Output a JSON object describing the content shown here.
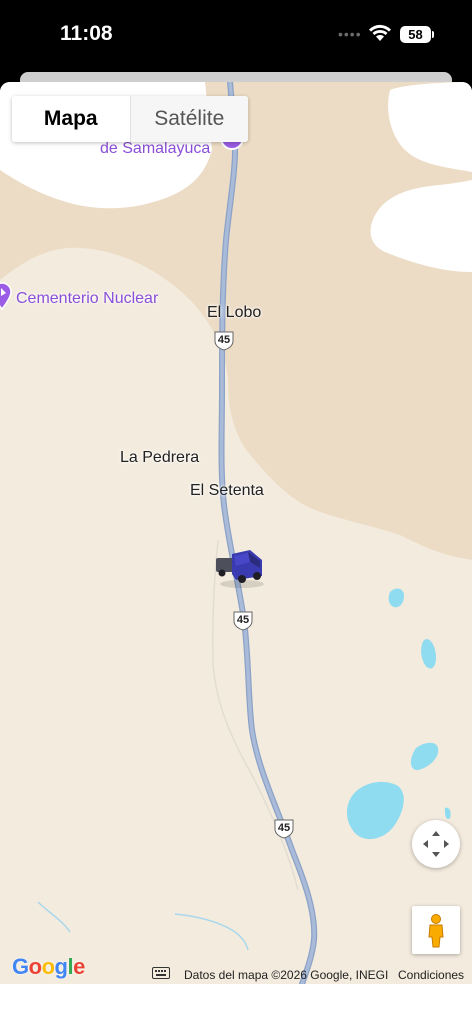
{
  "status_bar": {
    "time": "11:08",
    "battery": "58"
  },
  "map_type": {
    "map_label": "Mapa",
    "satellite_label": "Satélite"
  },
  "places": {
    "samalayuca": "de Samalayuca",
    "cementerio": "Cementerio Nuclear",
    "el_lobo": "El Lobo",
    "la_pedrera": "La Pedrera",
    "el_setenta": "El Setenta"
  },
  "highway_shields": [
    "45",
    "45",
    "45"
  ],
  "attribution": {
    "logo": "Google",
    "data_text": "Datos del mapa ©2026 Google, INEGI",
    "terms": "Condiciones"
  },
  "icons": {
    "vehicle": "truck-icon",
    "recenter": "recenter-icon",
    "street_view": "pegman-icon",
    "keyboard": "keyboard-icon",
    "poi": "poi-pin-icon"
  },
  "colors": {
    "poi": "#8a4fd8",
    "highway": "#9fb3d3",
    "water": "#8fdcf0",
    "land": "#f3ebde",
    "dunes": "#ecdcc5"
  }
}
